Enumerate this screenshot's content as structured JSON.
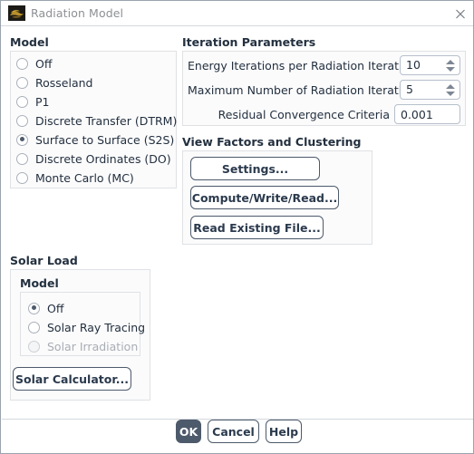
{
  "window": {
    "title": "Radiation Model",
    "icon": "fluent-app-icon",
    "close_icon": "close-icon"
  },
  "model_section": {
    "heading": "Model",
    "options": [
      {
        "label": "Off",
        "selected": false,
        "disabled": false
      },
      {
        "label": "Rosseland",
        "selected": false,
        "disabled": false
      },
      {
        "label": "P1",
        "selected": false,
        "disabled": false
      },
      {
        "label": "Discrete Transfer (DTRM)",
        "selected": false,
        "disabled": false
      },
      {
        "label": "Surface to Surface (S2S)",
        "selected": true,
        "disabled": false
      },
      {
        "label": "Discrete Ordinates (DO)",
        "selected": false,
        "disabled": false
      },
      {
        "label": "Monte Carlo (MC)",
        "selected": false,
        "disabled": false
      }
    ]
  },
  "solar_load_section": {
    "heading": "Solar Load",
    "model_label": "Model",
    "options": [
      {
        "label": "Off",
        "selected": true,
        "disabled": false
      },
      {
        "label": "Solar Ray Tracing",
        "selected": false,
        "disabled": false
      },
      {
        "label": "Solar Irradiation",
        "selected": false,
        "disabled": true
      }
    ],
    "solar_calculator_button": "Solar Calculator..."
  },
  "iteration_parameters": {
    "heading": "Iteration Parameters",
    "fields": [
      {
        "label": "Energy Iterations per Radiation Iteration",
        "value": "10",
        "type": "spinbox"
      },
      {
        "label": "Maximum Number of Radiation Iterations",
        "value": "5",
        "type": "spinbox"
      },
      {
        "label": "Residual Convergence Criteria",
        "value": "0.001",
        "type": "text"
      }
    ]
  },
  "view_factors_section": {
    "heading": "View Factors and Clustering",
    "buttons": [
      {
        "label": "Settings..."
      },
      {
        "label": "Compute/Write/Read..."
      },
      {
        "label": "Read Existing File..."
      }
    ]
  },
  "footer": {
    "ok_label": "OK",
    "cancel_label": "Cancel",
    "help_label": "Help"
  },
  "colors": {
    "accent": "#4d5a6b",
    "text": "#23303f",
    "border": "#dfe1e4",
    "group_bg": "#fbfbfc",
    "disabled_text": "#a8adb4"
  }
}
